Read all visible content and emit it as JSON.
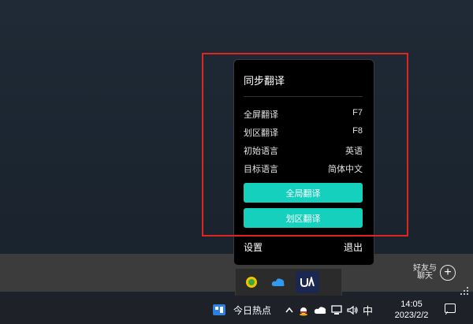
{
  "menu": {
    "title": "同步翻译",
    "rows": [
      {
        "label": "全屏翻译",
        "value": "F7"
      },
      {
        "label": "划区翻译",
        "value": "F8"
      },
      {
        "label": "初始语言",
        "value": "英语"
      },
      {
        "label": "目标语言",
        "value": "简体中文"
      }
    ],
    "primary_button": "全局翻译",
    "secondary_button": "划区翻译",
    "settings": "设置",
    "exit": "退出"
  },
  "widget": {
    "friend_chat": "好友与聊天",
    "add_icon": "plus-icon"
  },
  "taskbar": {
    "news_label": "今日热点",
    "ime": "中",
    "time": "14:05",
    "date": "2023/2/2"
  },
  "colors": {
    "accent": "#14d0bd",
    "highlight": "#e02424",
    "menu_bg": "#000000"
  }
}
